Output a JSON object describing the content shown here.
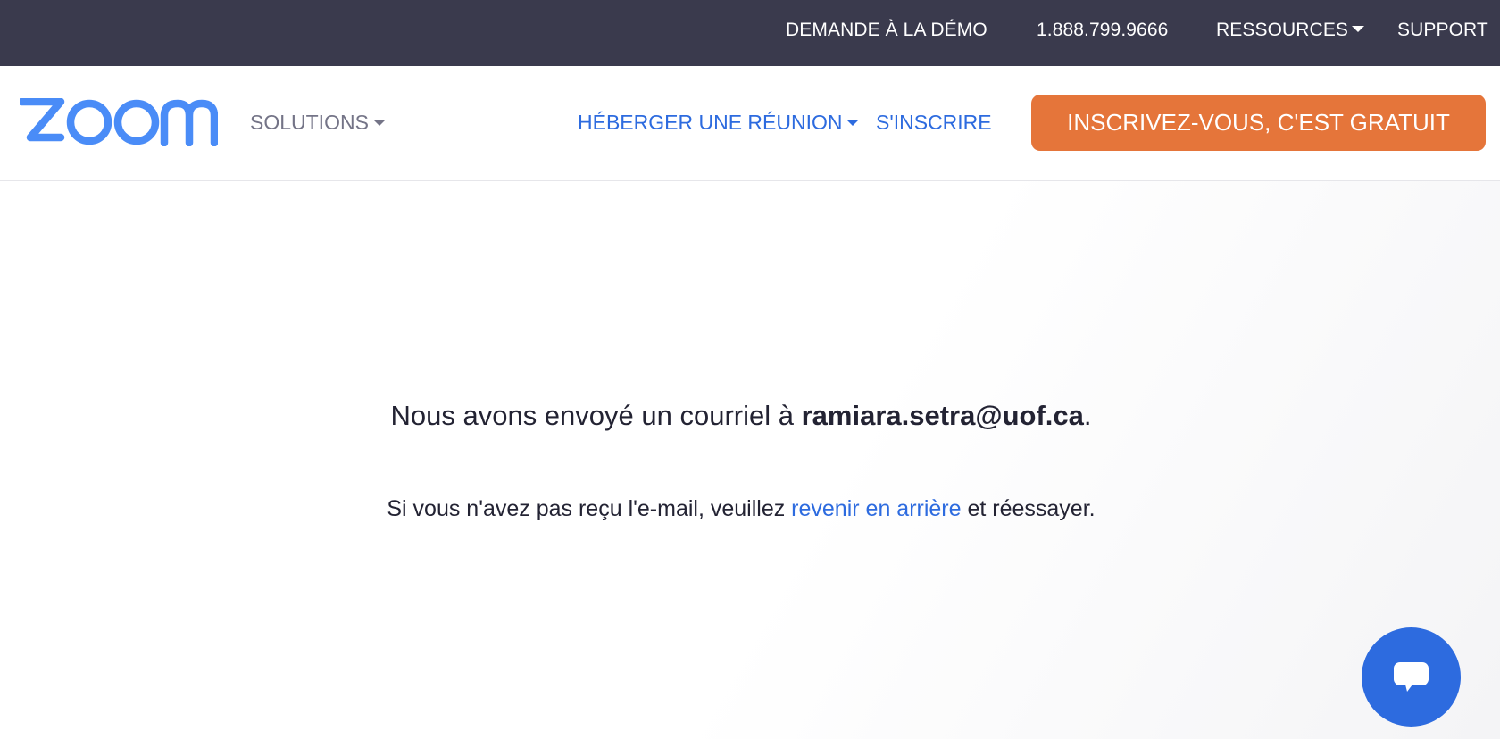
{
  "topbar": {
    "demo_label": "DEMANDE À LA DÉMO",
    "phone_label": "1.888.799.9666",
    "resources_label": "RESSOURCES",
    "support_label": "SUPPORT"
  },
  "header": {
    "logo_text": "zoom",
    "solutions_label": "SOLUTIONS",
    "host_label": "HÉBERGER UNE RÉUNION",
    "signin_label": "S'INSCRIRE",
    "signup_button_label": "INSCRIVEZ-VOUS, C'EST GRATUIT"
  },
  "main": {
    "sent_prefix": "Nous avons envoyé un courriel à ",
    "email": "ramiara.setra@uof.ca",
    "sent_suffix": ".",
    "retry_prefix": "Si vous n'avez pas reçu l'e-mail, veuillez ",
    "retry_link": "revenir en arrière",
    "retry_suffix": " et réessayer."
  },
  "icons": {
    "caret": "chevron-down-icon",
    "chat": "chat-icon"
  },
  "colors": {
    "topbar_bg": "#3a3a4d",
    "brand_blue": "#2d6bdf",
    "logo_blue": "#4a8cf7",
    "cta_orange": "#e5753a",
    "text_dark": "#232333",
    "nav_grey": "#747487"
  }
}
